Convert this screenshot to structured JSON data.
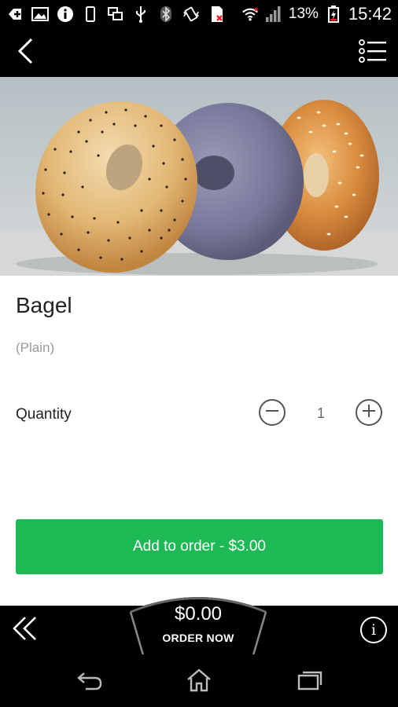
{
  "status_bar": {
    "battery_percent": "13%",
    "time": "15:42",
    "icons": [
      "add-icon",
      "image-icon",
      "info-icon",
      "phone-icon",
      "windows-icon",
      "usb-icon",
      "bluetooth-icon",
      "vibrate-icon",
      "sd-card-icon",
      "wifi-icon",
      "signal-icon",
      "battery-charging-icon"
    ]
  },
  "action_bar": {
    "back_icon": "chevron-left-icon",
    "menu_icon": "list-menu-icon"
  },
  "item": {
    "name": "Bagel",
    "option": "(Plain)",
    "quantity_label": "Quantity",
    "quantity": "1",
    "add_button_label": "Add to order - $3.00"
  },
  "bottom_bar": {
    "order_total": "$0.00",
    "order_now_label": "ORDER NOW",
    "info_glyph": "i"
  },
  "colors": {
    "accent_green": "#1db954",
    "bar_black": "#000000"
  }
}
